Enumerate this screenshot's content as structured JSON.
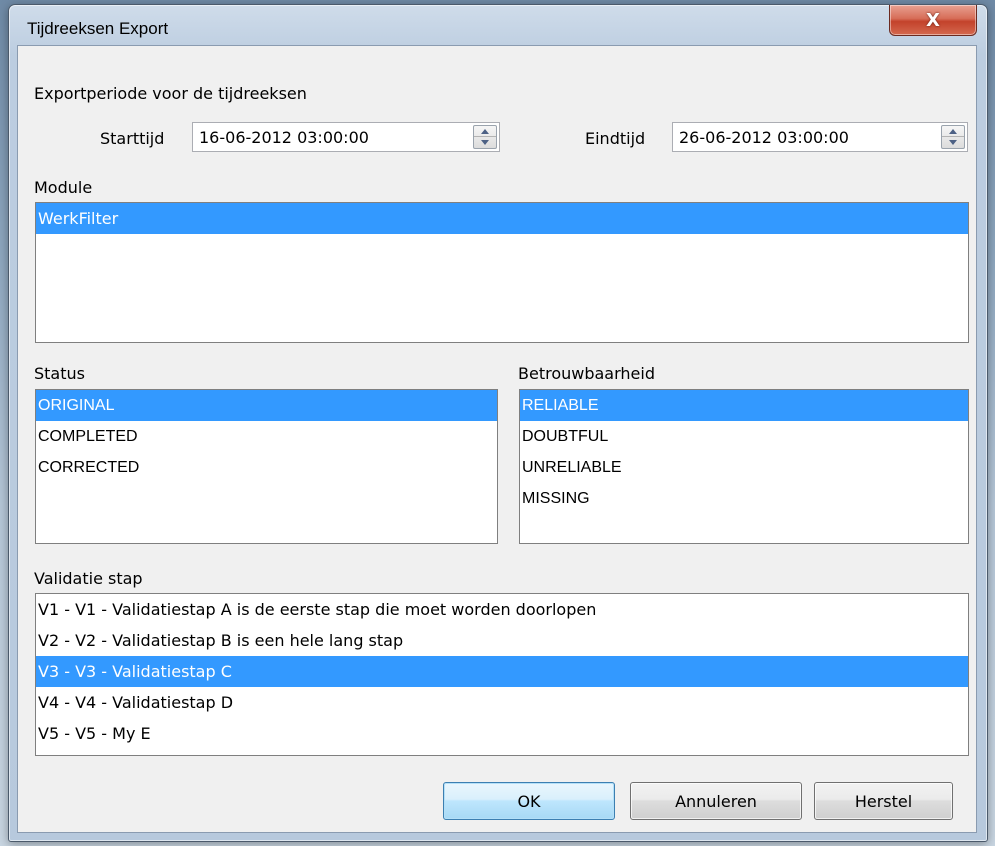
{
  "window": {
    "title": "Tijdreeksen Export",
    "close_label": "X"
  },
  "period": {
    "heading": "Exportperiode voor de tijdreeksen",
    "start_label": "Starttijd",
    "start_value": "16-06-2012 03:00:00",
    "end_label": "Eindtijd",
    "end_value": "26-06-2012 03:00:00"
  },
  "module": {
    "label": "Module",
    "items": [
      "WerkFilter"
    ]
  },
  "status": {
    "label": "Status",
    "items": [
      "ORIGINAL",
      "COMPLETED",
      "CORRECTED"
    ]
  },
  "reliability": {
    "label": "Betrouwbaarheid",
    "items": [
      "RELIABLE",
      "DOUBTFUL",
      "UNRELIABLE",
      "MISSING"
    ]
  },
  "validation": {
    "label": "Validatie stap",
    "items": [
      "V1 - V1 - Validatiestap A is de eerste stap die moet worden doorlopen",
      "V2 - V2 - Validatiestap B is een hele lang stap",
      "V3 - V3 - Validatiestap C",
      "V4 - V4 - Validatiestap D",
      "V5 - V5 - My E"
    ]
  },
  "buttons": {
    "ok": "OK",
    "cancel": "Annuleren",
    "reset": "Herstel"
  }
}
